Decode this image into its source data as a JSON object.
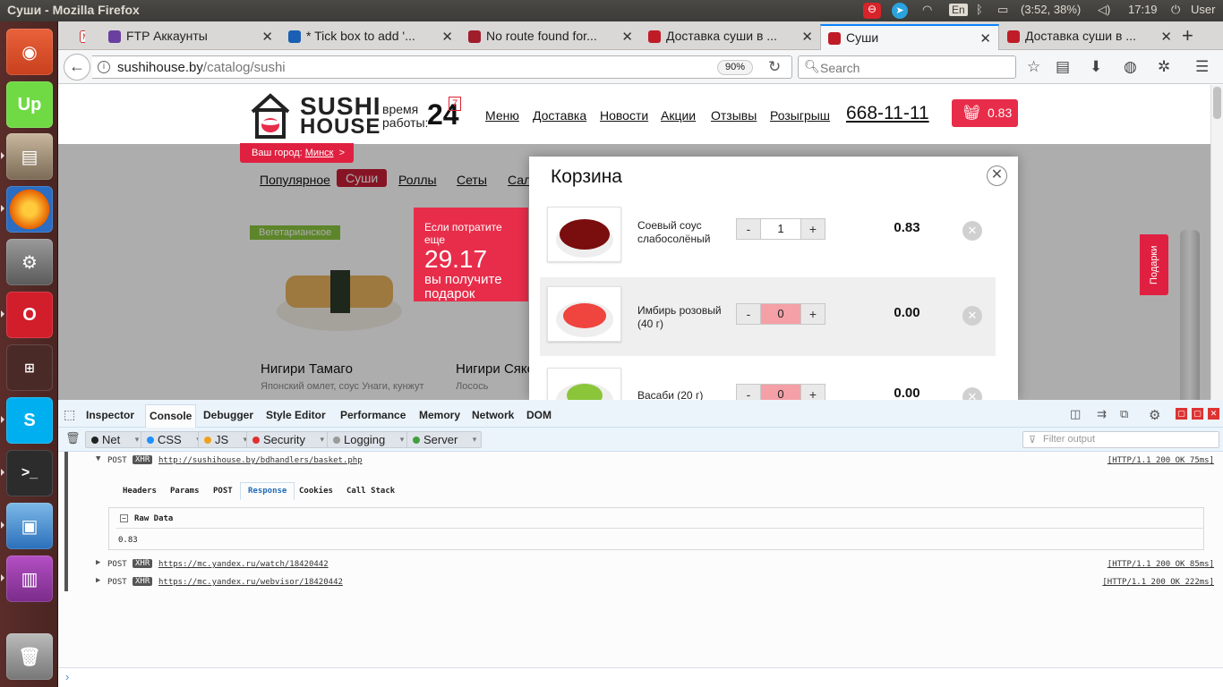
{
  "window": {
    "title": "Суши - Mozilla Firefox"
  },
  "panel": {
    "lang": "En",
    "battery": "(3:52, 38%)",
    "clock": "17:19",
    "user": "User"
  },
  "tabs": [
    {
      "label": "FTP Аккаунты",
      "fav_color": "#6b3fa0"
    },
    {
      "label": "* Tick box to add '...",
      "fav_color": "#1a5fb4"
    },
    {
      "label": "No route found for...",
      "fav_color": "#a01d2c"
    },
    {
      "label": "Доставка суши в ...",
      "fav_color": "#c01c28"
    },
    {
      "label": "Суши",
      "fav_color": "#c01c28",
      "active": true
    },
    {
      "label": "Доставка суши в ...",
      "fav_color": "#c01c28"
    }
  ],
  "nav": {
    "url_host": "sushihouse.by",
    "url_path": "/catalog/sushi",
    "zoom": "90%",
    "search_placeholder": "Search"
  },
  "site": {
    "logo_line1": "SUSHI",
    "logo_line2": "HOUSE",
    "hours_line1": "время",
    "hours_line2": "работы:",
    "hours": "24",
    "hours_badge": "7",
    "menu": [
      "Меню",
      "Доставка",
      "Новости",
      "Акции",
      "Отзывы",
      "Розыгрыш"
    ],
    "phone": "668-11-11",
    "cart_total": "0.83",
    "city_label": "Ваш город:",
    "city": "Минск",
    "categories": [
      "Популярное",
      "Суши",
      "Роллы",
      "Сеты",
      "Салаты"
    ],
    "active_category": "Суши",
    "cards": [
      {
        "badge": "Вегетарианское",
        "name": "Нигири Тамаго",
        "desc": "Японский омлет, соус Унаги, кунжут"
      },
      {
        "name": "Нигири Сяке",
        "desc": "Лосось"
      }
    ],
    "promo": {
      "line1": "Если потратите еще",
      "amount": "29.17",
      "line2": "вы получите",
      "line3": "подарок"
    },
    "gift_tab": "Подарки"
  },
  "basket": {
    "title": "Корзина",
    "items": [
      {
        "name": "Соевый соус слабосолёный",
        "qty": "1",
        "price": "0.83"
      },
      {
        "name": "Имбирь розовый (40 г)",
        "qty": "0",
        "price": "0.00"
      },
      {
        "name": "Васаби (20 г)",
        "qty": "0",
        "price": "0.00"
      }
    ],
    "minus": "-",
    "plus": "+"
  },
  "devtools": {
    "tabs": [
      "Inspector",
      "Console",
      "Debugger",
      "Style Editor",
      "Performance",
      "Memory",
      "Network",
      "DOM"
    ],
    "active_tab": "Console",
    "filters": [
      {
        "label": "Net",
        "color": "#222"
      },
      {
        "label": "CSS",
        "color": "#1e90ff"
      },
      {
        "label": "JS",
        "color": "#f0a020"
      },
      {
        "label": "Security",
        "color": "#e03030"
      },
      {
        "label": "Logging",
        "color": "#9a9a9a"
      },
      {
        "label": "Server",
        "color": "#40a040"
      }
    ],
    "filter_placeholder": "Filter output",
    "requests": [
      {
        "method": "POST",
        "type": "XHR",
        "url": "http://sushihouse.by/bdhandlers/basket.php",
        "status": "[HTTP/1.1 200 OK 75ms]"
      },
      {
        "method": "POST",
        "type": "XHR",
        "url": "https://mc.yandex.ru/watch/18420442",
        "status": "[HTTP/1.1 200 OK 85ms]"
      },
      {
        "method": "POST",
        "type": "XHR",
        "url": "https://mc.yandex.ru/webvisor/18420442",
        "status": "[HTTP/1.1 200 OK 222ms]"
      }
    ],
    "detail_tabs": [
      "Headers",
      "Params",
      "POST",
      "Response",
      "Cookies",
      "Call Stack"
    ],
    "detail_active": "Response",
    "raw_label": "Raw Data",
    "raw_value": "0.83"
  }
}
